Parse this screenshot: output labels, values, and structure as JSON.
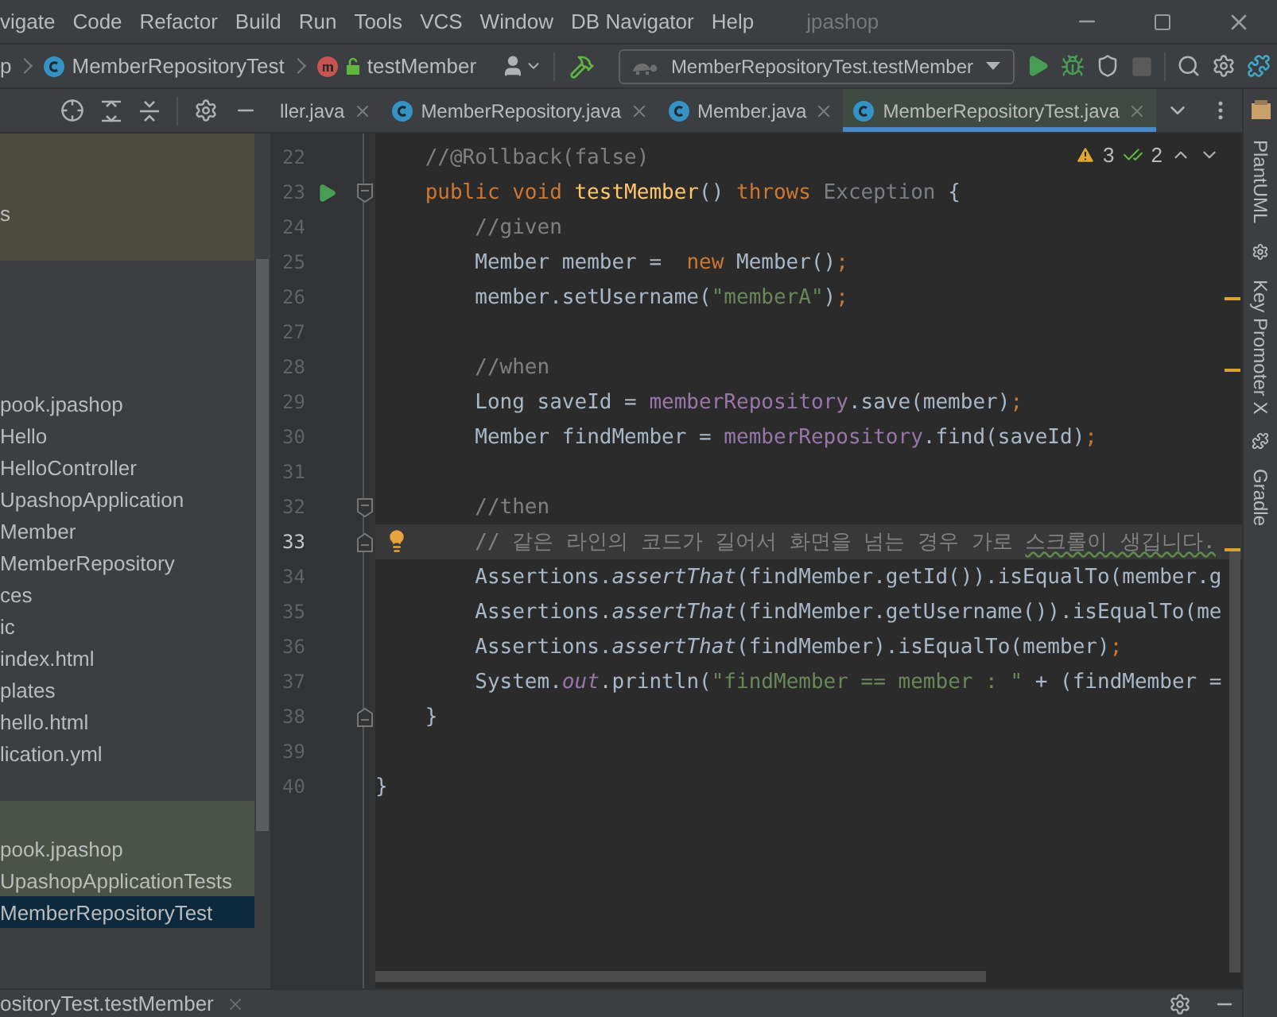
{
  "menu": [
    "vigate",
    "Code",
    "Refactor",
    "Build",
    "Run",
    "Tools",
    "VCS",
    "Window",
    "DB Navigator",
    "Help"
  ],
  "window": {
    "title": "jpashop"
  },
  "breadcrumbs": [
    {
      "label": "p",
      "kind": "folder"
    },
    {
      "label": "MemberRepositoryTest",
      "kind": "class"
    },
    {
      "label": "testMember",
      "kind": "method"
    }
  ],
  "toolbar": {
    "run_config": "MemberRepositoryTest.testMember",
    "stop_disabled": true
  },
  "tabs": [
    {
      "label": "ller.java",
      "selected": false
    },
    {
      "label": "MemberRepository.java",
      "selected": false
    },
    {
      "label": "Member.java",
      "selected": false
    },
    {
      "label": "MemberRepositoryTest.java",
      "selected": true
    }
  ],
  "project_tree": [
    {
      "color": "#4b4a3c",
      "selected": false
    },
    {
      "color": "#4b4a3c",
      "selected": false
    },
    {
      "label": "s",
      "color": "#4b4a3c",
      "selected": false
    },
    {
      "color": "#4b4a3c",
      "selected": false
    },
    {
      "selected": false
    },
    {
      "selected": false
    },
    {
      "selected": false
    },
    {
      "selected": false
    },
    {
      "label": "pook.jpashop",
      "selected": false
    },
    {
      "label": "Hello",
      "selected": false
    },
    {
      "label": "HelloController",
      "selected": false
    },
    {
      "label": "UpashopApplication",
      "selected": false
    },
    {
      "label": "Member",
      "selected": false
    },
    {
      "label": "MemberRepository",
      "selected": false
    },
    {
      "label": "ces",
      "selected": false
    },
    {
      "label": "ic",
      "selected": false
    },
    {
      "label": "index.html",
      "selected": false
    },
    {
      "label": "plates",
      "selected": false
    },
    {
      "label": "hello.html",
      "selected": false
    },
    {
      "label": "lication.yml",
      "selected": false
    },
    {
      "selected": false
    },
    {
      "color": "#4a5346",
      "selected": false
    },
    {
      "label": "pook.jpashop",
      "color": "#4a5346",
      "selected": false
    },
    {
      "label": "UpashopApplicationTests",
      "color": "#4a5346",
      "selected": false
    },
    {
      "label": "MemberRepositoryTest",
      "selected": true
    }
  ],
  "inspections": {
    "warnings": "3",
    "passed": "2"
  },
  "code": [
    {
      "number": "22",
      "current": false,
      "tokens": [
        {
          "text": "    //@Rollback(false)",
          "kind": "comment"
        }
      ]
    },
    {
      "number": "23",
      "current": false,
      "run": true,
      "fold_start": true,
      "tokens": [
        {
          "text": "    public void ",
          "kind": "keyword"
        },
        {
          "text": "testMember",
          "kind": "declaration"
        },
        {
          "text": "() ",
          "kind": "plain"
        },
        {
          "text": "throws ",
          "kind": "keyword"
        },
        {
          "text": "Exception",
          "kind": "faded"
        },
        {
          "text": " {",
          "kind": "plain"
        }
      ]
    },
    {
      "number": "24",
      "current": false,
      "tokens": [
        {
          "text": "        //given",
          "kind": "comment"
        }
      ]
    },
    {
      "number": "25",
      "current": false,
      "tokens": [
        {
          "text": "        Member member =  ",
          "kind": "plain"
        },
        {
          "text": "new ",
          "kind": "keyword"
        },
        {
          "text": "Member()",
          "kind": "plain"
        },
        {
          "text": ";",
          "kind": "keyword"
        }
      ]
    },
    {
      "number": "26",
      "current": false,
      "tokens": [
        {
          "text": "        member.setUsername(",
          "kind": "plain"
        },
        {
          "text": "\"memberA\"",
          "kind": "string"
        },
        {
          "text": ")",
          "kind": "plain"
        },
        {
          "text": ";",
          "kind": "keyword"
        }
      ]
    },
    {
      "number": "27",
      "current": false
    },
    {
      "number": "28",
      "current": false,
      "tokens": [
        {
          "text": "        //when",
          "kind": "comment"
        }
      ]
    },
    {
      "number": "29",
      "current": false,
      "tokens": [
        {
          "text": "        Long saveId = ",
          "kind": "plain"
        },
        {
          "text": "memberRepository",
          "kind": "field"
        },
        {
          "text": ".save(member)",
          "kind": "plain"
        },
        {
          "text": ";",
          "kind": "keyword"
        }
      ]
    },
    {
      "number": "30",
      "current": false,
      "tokens": [
        {
          "text": "        Member findMember = ",
          "kind": "plain"
        },
        {
          "text": "memberRepository",
          "kind": "field"
        },
        {
          "text": ".find(saveId)",
          "kind": "plain"
        },
        {
          "text": ";",
          "kind": "keyword"
        }
      ]
    },
    {
      "number": "31",
      "current": false
    },
    {
      "number": "32",
      "current": false,
      "fold_start": true,
      "tokens": [
        {
          "text": "        //then",
          "kind": "comment"
        }
      ]
    },
    {
      "number": "33",
      "current": true,
      "fold_end": true,
      "bulb": true,
      "tokens": [
        {
          "text": "        // 같은 라인의 코드가 길어서 화면을 넘는 경우 가로 ",
          "kind": "comment"
        },
        {
          "text": "스크롤이 생깁니다.",
          "kind": "typo"
        }
      ]
    },
    {
      "number": "34",
      "current": false,
      "tokens": [
        {
          "text": "        Assertions.",
          "kind": "plain"
        },
        {
          "text": "assertThat",
          "kind": "static_call"
        },
        {
          "text": "(findMember.getId()).isEqualTo(member.g",
          "kind": "plain"
        }
      ]
    },
    {
      "number": "35",
      "current": false,
      "tokens": [
        {
          "text": "        Assertions.",
          "kind": "plain"
        },
        {
          "text": "assertThat",
          "kind": "static_call"
        },
        {
          "text": "(findMember.getUsername()).isEqualTo(me",
          "kind": "plain"
        }
      ]
    },
    {
      "number": "36",
      "current": false,
      "tokens": [
        {
          "text": "        Assertions.",
          "kind": "plain"
        },
        {
          "text": "assertThat",
          "kind": "static_call"
        },
        {
          "text": "(findMember).isEqualTo(member)",
          "kind": "plain"
        },
        {
          "text": ";",
          "kind": "keyword"
        }
      ]
    },
    {
      "number": "37",
      "current": false,
      "tokens": [
        {
          "text": "        System.",
          "kind": "plain"
        },
        {
          "text": "out",
          "kind": "static_field"
        },
        {
          "text": ".println(",
          "kind": "plain"
        },
        {
          "text": "\"findMember == member : \"",
          "kind": "string"
        },
        {
          "text": " + (findMember =",
          "kind": "plain"
        }
      ]
    },
    {
      "number": "38",
      "current": false,
      "fold_end": true,
      "tokens": [
        {
          "text": "    }",
          "kind": "plain"
        }
      ]
    },
    {
      "number": "39",
      "current": false
    },
    {
      "number": "40",
      "current": false,
      "tokens": [
        {
          "text": "}",
          "kind": "plain"
        }
      ]
    }
  ],
  "side_tools": [
    {
      "label": "PlantUML",
      "kind": "plain"
    },
    {
      "label": "Key Promoter X",
      "kind": "plugin"
    },
    {
      "label": "Gradle",
      "kind": "gradle"
    }
  ],
  "bottom_panel": {
    "tab": "ositoryTest.testMember"
  }
}
